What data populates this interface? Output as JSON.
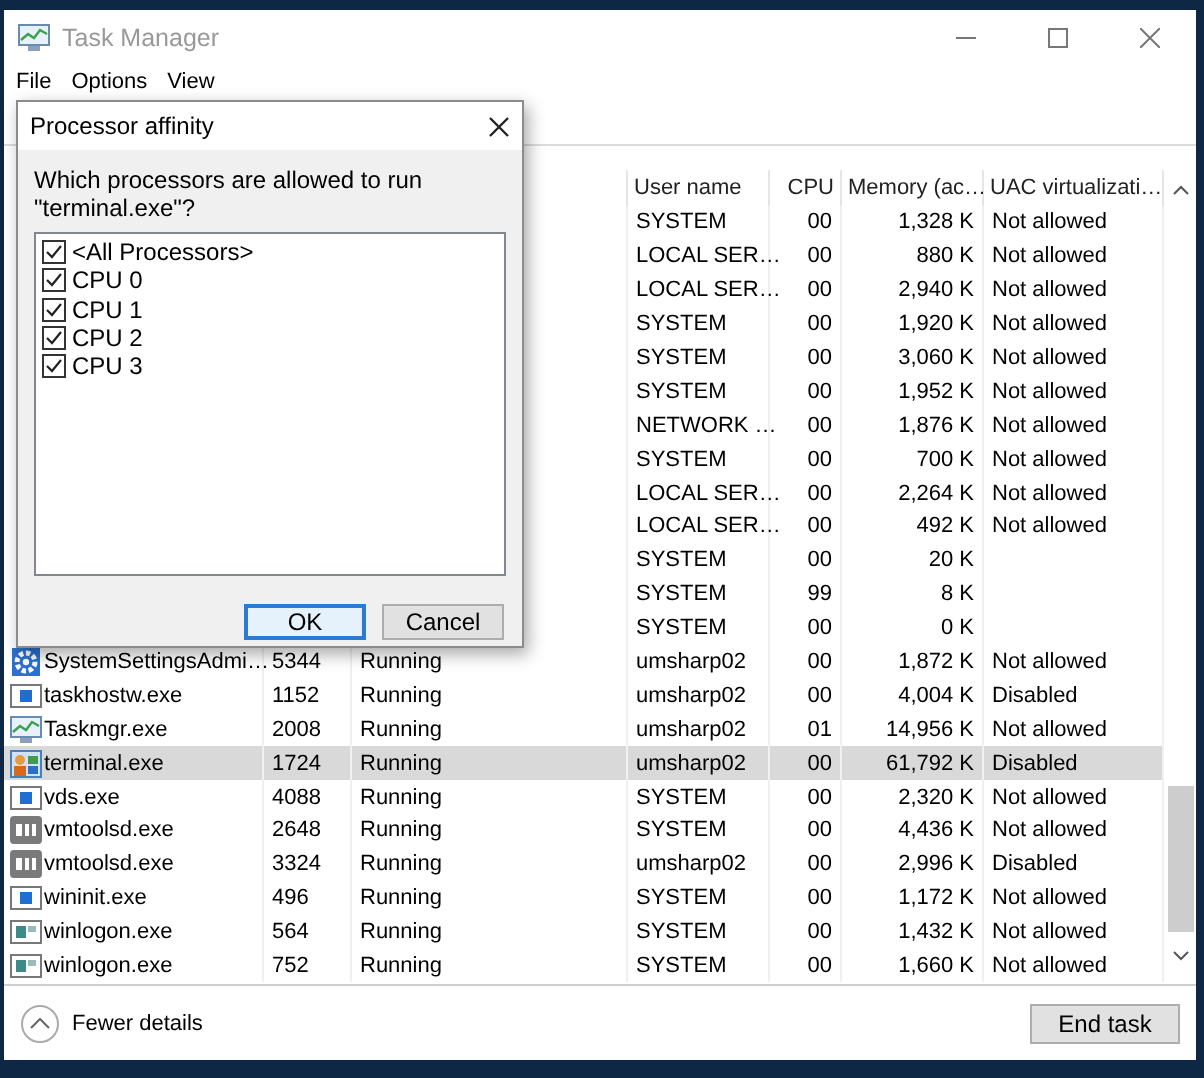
{
  "window": {
    "title": "Task Manager"
  },
  "menu": [
    "File",
    "Options",
    "View"
  ],
  "table": {
    "columns": [
      "User name",
      "CPU",
      "Memory (ac…",
      "UAC virtualizati…"
    ],
    "rows": [
      {
        "user": "SYSTEM",
        "cpu": "00",
        "memory": "1,328 K",
        "uac": "Not allowed",
        "selected": false
      },
      {
        "user": "LOCAL SER…",
        "cpu": "00",
        "memory": "880 K",
        "uac": "Not allowed",
        "selected": false
      },
      {
        "user": "LOCAL SER…",
        "cpu": "00",
        "memory": "2,940 K",
        "uac": "Not allowed",
        "selected": false
      },
      {
        "user": "SYSTEM",
        "cpu": "00",
        "memory": "1,920 K",
        "uac": "Not allowed",
        "selected": false
      },
      {
        "user": "SYSTEM",
        "cpu": "00",
        "memory": "3,060 K",
        "uac": "Not allowed",
        "selected": false
      },
      {
        "user": "SYSTEM",
        "cpu": "00",
        "memory": "1,952 K",
        "uac": "Not allowed",
        "selected": false
      },
      {
        "user": "NETWORK …",
        "cpu": "00",
        "memory": "1,876 K",
        "uac": "Not allowed",
        "selected": false
      },
      {
        "user": "SYSTEM",
        "cpu": "00",
        "memory": "700 K",
        "uac": "Not allowed",
        "selected": false
      },
      {
        "user": "LOCAL SER…",
        "cpu": "00",
        "memory": "2,264 K",
        "uac": "Not allowed",
        "selected": false
      },
      {
        "user": "LOCAL SER…",
        "cpu": "00",
        "memory": "492 K",
        "uac": "Not allowed",
        "selected": false
      },
      {
        "user": "SYSTEM",
        "cpu": "00",
        "memory": "20 K",
        "selected": false
      },
      {
        "user": "SYSTEM",
        "cpu": "99",
        "memory": "8 K",
        "selected": false
      },
      {
        "user": "SYSTEM",
        "cpu": "00",
        "memory": "0 K",
        "selected": false
      },
      {
        "kind": "gear",
        "name": "SystemSettingsAdmi…",
        "pid": "5344",
        "status": "Running",
        "user": "umsharp02",
        "cpu": "00",
        "memory": "1,872 K",
        "uac": "Not allowed",
        "selected": false
      },
      {
        "kind": "window",
        "name": "taskhostw.exe",
        "pid": "1152",
        "status": "Running",
        "user": "umsharp02",
        "cpu": "00",
        "memory": "4,004 K",
        "uac": "Disabled",
        "selected": false
      },
      {
        "kind": "monitor",
        "name": "Taskmgr.exe",
        "pid": "2008",
        "status": "Running",
        "user": "umsharp02",
        "cpu": "01",
        "memory": "14,956 K",
        "uac": "Not allowed",
        "selected": false
      },
      {
        "kind": "app",
        "name": "terminal.exe",
        "pid": "1724",
        "status": "Running",
        "user": "umsharp02",
        "cpu": "00",
        "memory": "61,792 K",
        "uac": "Disabled",
        "selected": true
      },
      {
        "kind": "window",
        "name": "vds.exe",
        "pid": "4088",
        "status": "Running",
        "user": "SYSTEM",
        "cpu": "00",
        "memory": "2,320 K",
        "uac": "Not allowed",
        "selected": false
      },
      {
        "kind": "vm",
        "name": "vmtoolsd.exe",
        "pid": "2648",
        "status": "Running",
        "user": "SYSTEM",
        "cpu": "00",
        "memory": "4,436 K",
        "uac": "Not allowed",
        "selected": false
      },
      {
        "kind": "vm",
        "name": "vmtoolsd.exe",
        "pid": "3324",
        "status": "Running",
        "user": "umsharp02",
        "cpu": "00",
        "memory": "2,996 K",
        "uac": "Disabled",
        "selected": false
      },
      {
        "kind": "window",
        "name": "wininit.exe",
        "pid": "496",
        "status": "Running",
        "user": "SYSTEM",
        "cpu": "00",
        "memory": "1,172 K",
        "uac": "Not allowed",
        "selected": false
      },
      {
        "kind": "logon",
        "name": "winlogon.exe",
        "pid": "564",
        "status": "Running",
        "user": "SYSTEM",
        "cpu": "00",
        "memory": "1,432 K",
        "uac": "Not allowed",
        "selected": false
      },
      {
        "kind": "logon",
        "name": "winlogon.exe",
        "pid": "752",
        "status": "Running",
        "user": "SYSTEM",
        "cpu": "00",
        "memory": "1,660 K",
        "uac": "Not allowed",
        "selected": false
      }
    ]
  },
  "footer": {
    "details": "Fewer details",
    "end_task": "End task"
  },
  "dialog": {
    "title": "Processor affinity",
    "prompt": "Which processors are allowed to run \"terminal.exe\"?",
    "processors": [
      {
        "label": "<All Processors>",
        "checked": true
      },
      {
        "label": "CPU 0",
        "checked": true
      },
      {
        "label": "CPU 1",
        "checked": true
      },
      {
        "label": "CPU 2",
        "checked": true
      },
      {
        "label": "CPU 3",
        "checked": true
      }
    ],
    "buttons": [
      {
        "label": "OK",
        "default": true
      },
      {
        "label": "Cancel",
        "default": false
      }
    ]
  }
}
